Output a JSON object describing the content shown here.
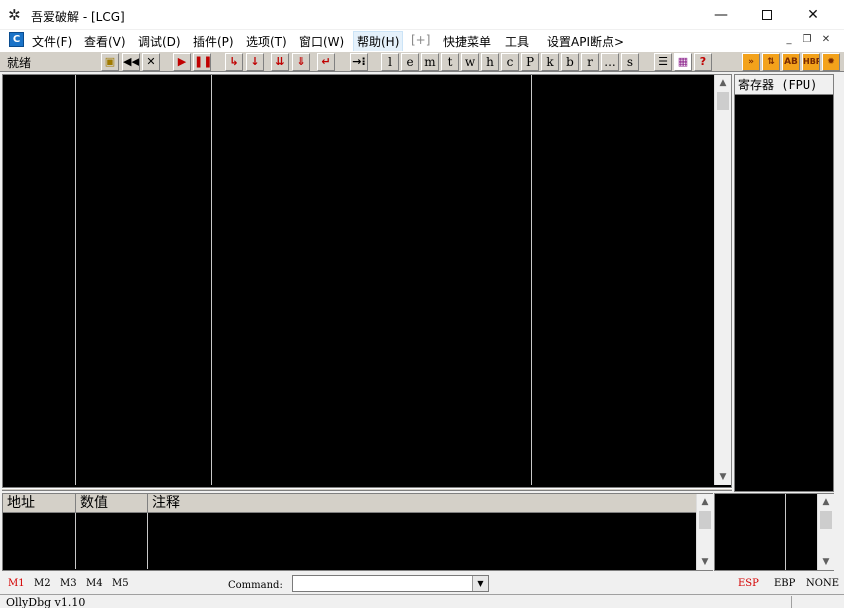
{
  "window": {
    "title": "吾爱破解 - [LCG]",
    "min_glyph": "—",
    "close_glyph": "✕"
  },
  "menu": {
    "items": [
      {
        "label": "文件(F)"
      },
      {
        "label": "查看(V)"
      },
      {
        "label": "调试(D)"
      },
      {
        "label": "插件(P)"
      },
      {
        "label": "选项(T)"
      },
      {
        "label": "窗口(W)"
      },
      {
        "label": "帮助(H)"
      },
      {
        "label": "[+]"
      },
      {
        "label": "快捷菜单"
      },
      {
        "label": "工具"
      },
      {
        "label": "设置API断点>"
      }
    ],
    "mdi_icon_glyph": "C",
    "mdi_min": "_",
    "mdi_restore": "❐",
    "mdi_close": "✕"
  },
  "toolbar": {
    "status": "就绪",
    "letters": [
      "l",
      "e",
      "m",
      "t",
      "w",
      "h",
      "c",
      "P",
      "k",
      "b",
      "r",
      "...",
      "s"
    ],
    "plugin_buttons": [
      "HBP"
    ]
  },
  "registers": {
    "title": "寄存器 (FPU)"
  },
  "dump": {
    "columns": [
      "地址",
      "数值",
      "注释"
    ]
  },
  "command_bar": {
    "tabs": [
      "M1",
      "M2",
      "M3",
      "M4",
      "M5"
    ],
    "active_tab": "M1",
    "label": "Command:",
    "value": "",
    "reg_tabs": [
      "ESP",
      "EBP",
      "NONE"
    ],
    "active_reg_tab": "ESP"
  },
  "status_bar": {
    "text": "OllyDbg v1.10"
  },
  "colors": {
    "pane_bg": "#000000",
    "toolbar_bg": "#d4d0c8",
    "active_red": "#d40000",
    "toolbar_red": "#c00000"
  }
}
